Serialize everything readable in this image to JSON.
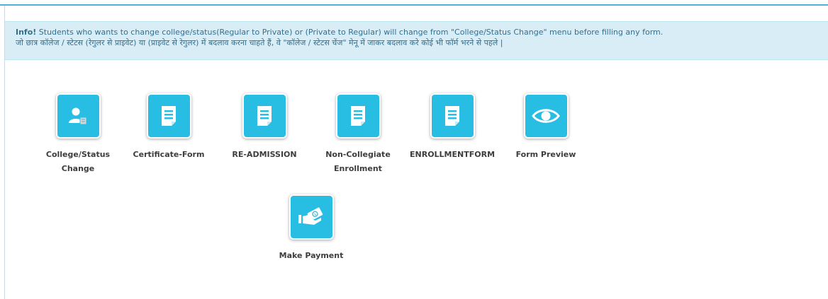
{
  "info": {
    "prefix": "Info!",
    "line1": " Students who wants to change college/status(Regular to Private) or (Private to Regular) will change from \"College/Status Change\" menu before filling any form.",
    "line2": "जो छात्र कॉलेज / स्टेटस (रेगुलर से प्राइवेट) या (प्राइवेट से रेगुलर) में बदलाव करना चाहते हैं, वे \"कॉलेज / स्टेटस चेंज\" मेनू में जाकर बदलाव करे कोई भी फॉर्म भरने से पहले |"
  },
  "tiles": [
    {
      "label_line1": "College/Status",
      "label_line2": "Change",
      "icon": "user-edit-icon"
    },
    {
      "label_line1": "Certificate-Form",
      "label_line2": "",
      "icon": "document-icon"
    },
    {
      "label_line1": "RE-ADMISSION",
      "label_line2": "",
      "icon": "document-icon"
    },
    {
      "label_line1": "Non-Collegiate",
      "label_line2": "Enrollment",
      "icon": "document-icon"
    },
    {
      "label_line1": "ENROLLMENTFORM",
      "label_line2": "",
      "icon": "document-icon"
    },
    {
      "label_line1": "Form Preview",
      "label_line2": "",
      "icon": "eye-icon"
    },
    {
      "label_line1": "Make Payment",
      "label_line2": "",
      "icon": "payment-icon"
    }
  ],
  "colors": {
    "tile": "#28bde3",
    "alert_bg": "#d9edf7",
    "alert_text": "#31708f",
    "rule": "#4db3dc"
  }
}
